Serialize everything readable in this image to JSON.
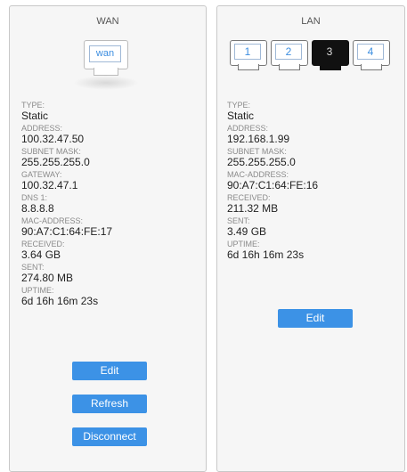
{
  "wan": {
    "title": "WAN",
    "port_label": "wan",
    "fields": [
      {
        "label": "TYPE:",
        "value": "Static"
      },
      {
        "label": "ADDRESS:",
        "value": "100.32.47.50"
      },
      {
        "label": "SUBNET MASK:",
        "value": "255.255.255.0"
      },
      {
        "label": "GATEWAY:",
        "value": "100.32.47.1"
      },
      {
        "label": "DNS 1:",
        "value": "8.8.8.8"
      },
      {
        "label": "MAC-ADDRESS:",
        "value": "90:A7:C1:64:FE:17"
      },
      {
        "label": "RECEIVED:",
        "value": "3.64 GB"
      },
      {
        "label": "SENT:",
        "value": "274.80 MB"
      },
      {
        "label": "UPTIME:",
        "value": "6d 16h 16m 23s"
      }
    ],
    "buttons": {
      "edit": "Edit",
      "refresh": "Refresh",
      "disconnect": "Disconnect"
    }
  },
  "lan": {
    "title": "LAN",
    "ports": [
      {
        "label": "1",
        "active": false
      },
      {
        "label": "2",
        "active": false
      },
      {
        "label": "3",
        "active": true
      },
      {
        "label": "4",
        "active": false
      }
    ],
    "fields": [
      {
        "label": "TYPE:",
        "value": "Static"
      },
      {
        "label": "ADDRESS:",
        "value": "192.168.1.99"
      },
      {
        "label": "SUBNET MASK:",
        "value": "255.255.255.0"
      },
      {
        "label": "MAC-ADDRESS:",
        "value": "90:A7:C1:64:FE:16"
      },
      {
        "label": "RECEIVED:",
        "value": "211.32 MB"
      },
      {
        "label": "SENT:",
        "value": "3.49 GB"
      },
      {
        "label": "UPTIME:",
        "value": "6d 16h 16m 23s"
      }
    ],
    "buttons": {
      "edit": "Edit"
    }
  },
  "colors": {
    "accent": "#3c92e6",
    "port_label": "#3b8de0",
    "active_port": "#111111"
  }
}
